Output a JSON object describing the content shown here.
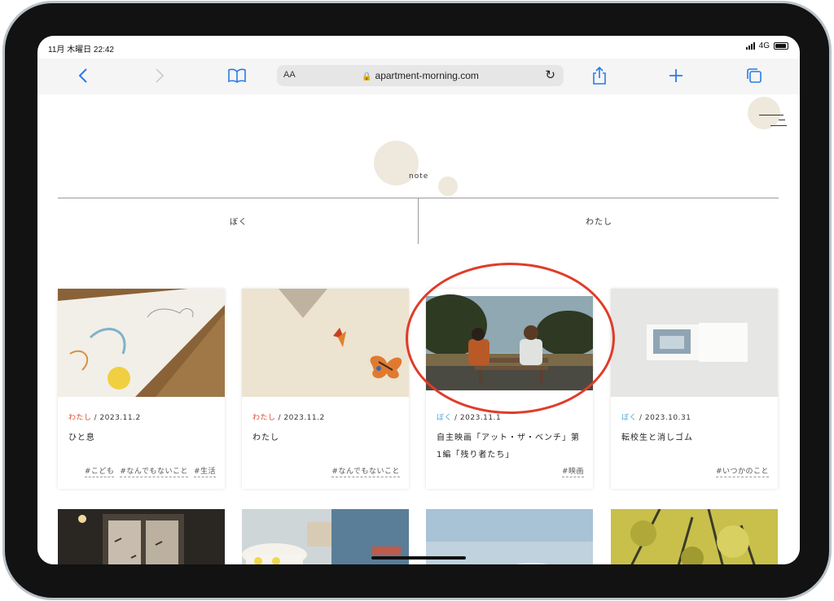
{
  "status_bar": {
    "time": "11月 木曜日 22:42",
    "network": "4G"
  },
  "browser": {
    "text_size_label": "AA",
    "url": "apartment-morning.com",
    "accent_color": "#2a7be4",
    "buttons": {
      "back": "back-icon",
      "forward": "forward-icon",
      "bookmarks": "book-icon",
      "reload": "reload-icon",
      "share": "share-icon",
      "new_tab": "plus-icon",
      "tabs": "tabs-icon"
    }
  },
  "site": {
    "logo": "note",
    "tabs": [
      {
        "label": "ぼく"
      },
      {
        "label": "わたし"
      }
    ],
    "category_colors": {
      "わたし": "#e0452a",
      "ぼく": "#4aa3d8"
    },
    "posts": [
      {
        "category": "わたし",
        "date": "/ 2023.11.2",
        "title": "ひと息",
        "tags": [
          "#こども",
          "#なんでもないこと",
          "#生活"
        ]
      },
      {
        "category": "わたし",
        "date": "/ 2023.11.2",
        "title": "わたし",
        "tags": [
          "#なんでもないこと"
        ]
      },
      {
        "category": "ぼく",
        "date": "/ 2023.11.1",
        "title": "自主映画「アット・ザ・ベンチ」第1編「残り者たち」",
        "tags": [
          "#映画"
        ]
      },
      {
        "category": "ぼく",
        "date": "/ 2023.10.31",
        "title": "転校生と消しゴム",
        "tags": [
          "#いつかのこと"
        ]
      }
    ]
  }
}
